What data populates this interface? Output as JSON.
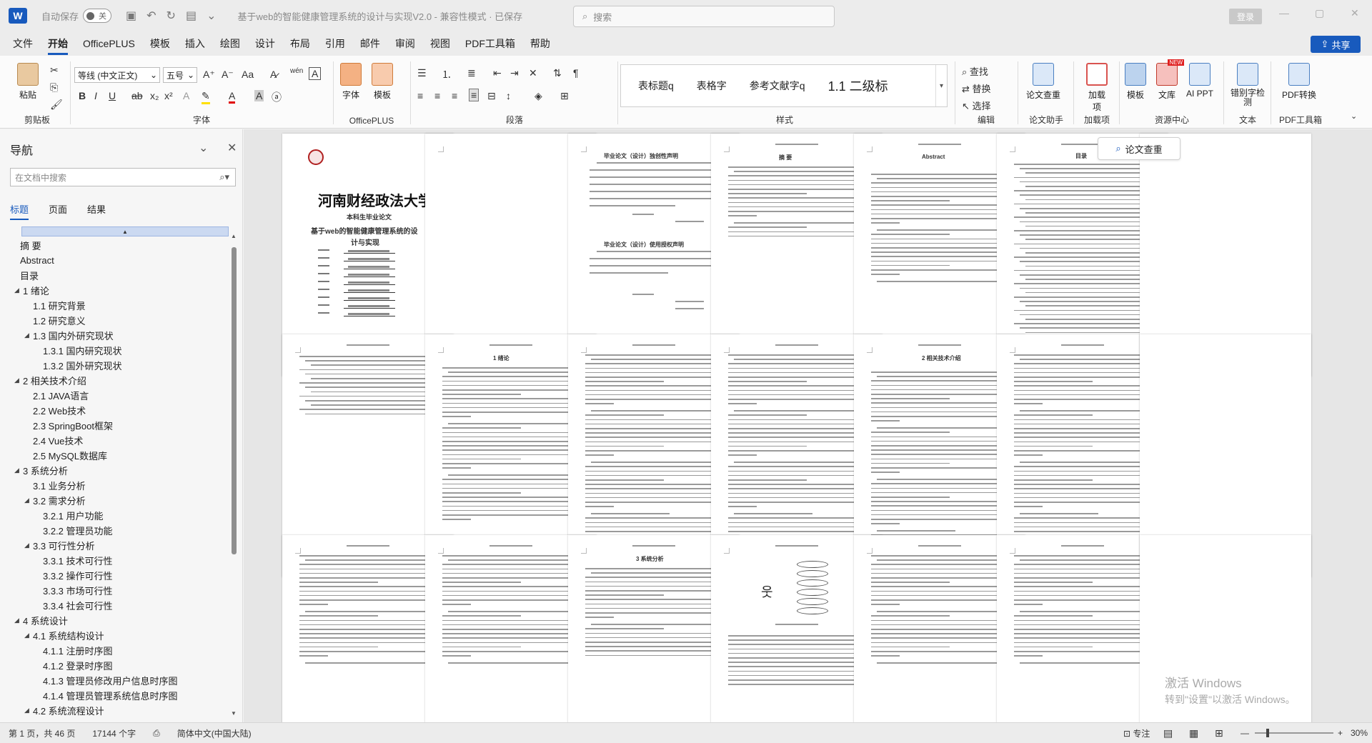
{
  "titlebar": {
    "autosave_label": "自动保存",
    "autosave_state": "关",
    "doc_title": "基于web的智能健康管理系统的设计与实现V2.0  -  兼容性模式 · 已保存",
    "search_placeholder": "搜索",
    "login_label": "登录"
  },
  "menu": {
    "tabs": [
      "文件",
      "开始",
      "OfficePLUS",
      "模板",
      "插入",
      "绘图",
      "设计",
      "布局",
      "引用",
      "邮件",
      "审阅",
      "视图",
      "PDF工具箱",
      "帮助"
    ],
    "active_index": 1,
    "share_label": "共享"
  },
  "ribbon": {
    "clipboard": {
      "paste": "粘贴",
      "label": "剪贴板"
    },
    "font": {
      "family": "等线 (中文正文)",
      "size": "五号",
      "label": "字体"
    },
    "officeplus": {
      "font_btn": "字体",
      "template_btn": "模板",
      "label": "OfficePLUS"
    },
    "paragraph": {
      "label": "段落"
    },
    "styles": {
      "items": [
        "表标题q",
        "表格字",
        "参考文献字q",
        "1.1  二级标"
      ],
      "label": "样式"
    },
    "editing": {
      "find": "查找",
      "replace": "替换",
      "select": "选择",
      "label": "编辑"
    },
    "paper_check": {
      "btn": "论文查重",
      "label": "论文助手"
    },
    "plugin": {
      "btn": "加载项",
      "label": "加载项"
    },
    "resources": {
      "template": "模板",
      "library": "文库",
      "ai_ppt": "AI PPT",
      "new_badge": "NEW",
      "label": "资源中心"
    },
    "text": {
      "btn": "错别字检测",
      "label": "文本"
    },
    "pdf": {
      "btn": "PDF转换",
      "label": "PDF工具箱"
    }
  },
  "nav": {
    "title": "导航",
    "search_placeholder": "在文档中搜索",
    "tabs": [
      "标题",
      "页面",
      "结果"
    ],
    "active_tab": 0,
    "items": [
      {
        "label": "摘  要",
        "level": 1,
        "arrow": ""
      },
      {
        "label": "Abstract",
        "level": 1,
        "arrow": ""
      },
      {
        "label": "目录",
        "level": 1,
        "arrow": ""
      },
      {
        "label": "1 绪论",
        "level": 1,
        "arrow": "▲"
      },
      {
        "label": "1.1 研究背景",
        "level": 2,
        "arrow": ""
      },
      {
        "label": "1.2 研究意义",
        "level": 2,
        "arrow": ""
      },
      {
        "label": "1.3 国内外研究现状",
        "level": 2,
        "arrow": "▲"
      },
      {
        "label": "1.3.1 国内研究现状",
        "level": 3,
        "arrow": ""
      },
      {
        "label": "1.3.2 国外研究现状",
        "level": 3,
        "arrow": ""
      },
      {
        "label": "2 相关技术介绍",
        "level": 1,
        "arrow": "▲"
      },
      {
        "label": "2.1  JAVA语言",
        "level": 2,
        "arrow": ""
      },
      {
        "label": "2.2 Web技术",
        "level": 2,
        "arrow": ""
      },
      {
        "label": "2.3 SpringBoot框架",
        "level": 2,
        "arrow": ""
      },
      {
        "label": "2.4  Vue技术",
        "level": 2,
        "arrow": ""
      },
      {
        "label": "2.5  MySQL数据库",
        "level": 2,
        "arrow": ""
      },
      {
        "label": "3 系统分析",
        "level": 1,
        "arrow": "▲"
      },
      {
        "label": "3.1 业务分析",
        "level": 2,
        "arrow": ""
      },
      {
        "label": "3.2 需求分析",
        "level": 2,
        "arrow": "▲"
      },
      {
        "label": "3.2.1 用户功能",
        "level": 3,
        "arrow": ""
      },
      {
        "label": "3.2.2 管理员功能",
        "level": 3,
        "arrow": ""
      },
      {
        "label": "3.3 可行性分析",
        "level": 2,
        "arrow": "▲"
      },
      {
        "label": "3.3.1 技术可行性",
        "level": 3,
        "arrow": ""
      },
      {
        "label": "3.3.2 操作可行性",
        "level": 3,
        "arrow": ""
      },
      {
        "label": "3.3.3 市场可行性",
        "level": 3,
        "arrow": ""
      },
      {
        "label": "3.3.4 社会可行性",
        "level": 3,
        "arrow": ""
      },
      {
        "label": "4 系统设计",
        "level": 1,
        "arrow": "▲"
      },
      {
        "label": "4.1 系统结构设计",
        "level": 2,
        "arrow": "▲"
      },
      {
        "label": "4.1.1 注册时序图",
        "level": 3,
        "arrow": ""
      },
      {
        "label": "4.1.2 登录时序图",
        "level": 3,
        "arrow": ""
      },
      {
        "label": "4.1.3 管理员修改用户信息时序图",
        "level": 3,
        "arrow": ""
      },
      {
        "label": "4.1.4 管理员管理系统信息时序图",
        "level": 3,
        "arrow": ""
      },
      {
        "label": "4.2 系统流程设计",
        "level": 2,
        "arrow": "▲"
      }
    ]
  },
  "document": {
    "cover_university": "河南财经政法大学",
    "cover_subtitle": "本科生毕业论文",
    "cover_title_1": "基于web的智能健康管理系统的设",
    "cover_title_2": "计与实现",
    "page_headings": {
      "declaration": "毕业论文（设计）独创性声明",
      "authorization": "毕业论文（设计）使用授权声明",
      "abstract_cn": "摘  要",
      "abstract_en": "Abstract",
      "toc": "目录",
      "ch1": "1  绪论",
      "ch2": "2  相关技术介绍",
      "ch3": "3  系统分析"
    },
    "floating_btn": "论文查重"
  },
  "statusbar": {
    "page_info": "第 1 页，共 46 页",
    "word_count": "17144 个字",
    "language": "简体中文(中国大陆)",
    "focus": "专注",
    "zoom": "30%"
  },
  "watermark": {
    "line1": "激活 Windows",
    "line2": "转到\"设置\"以激活 Windows。"
  }
}
